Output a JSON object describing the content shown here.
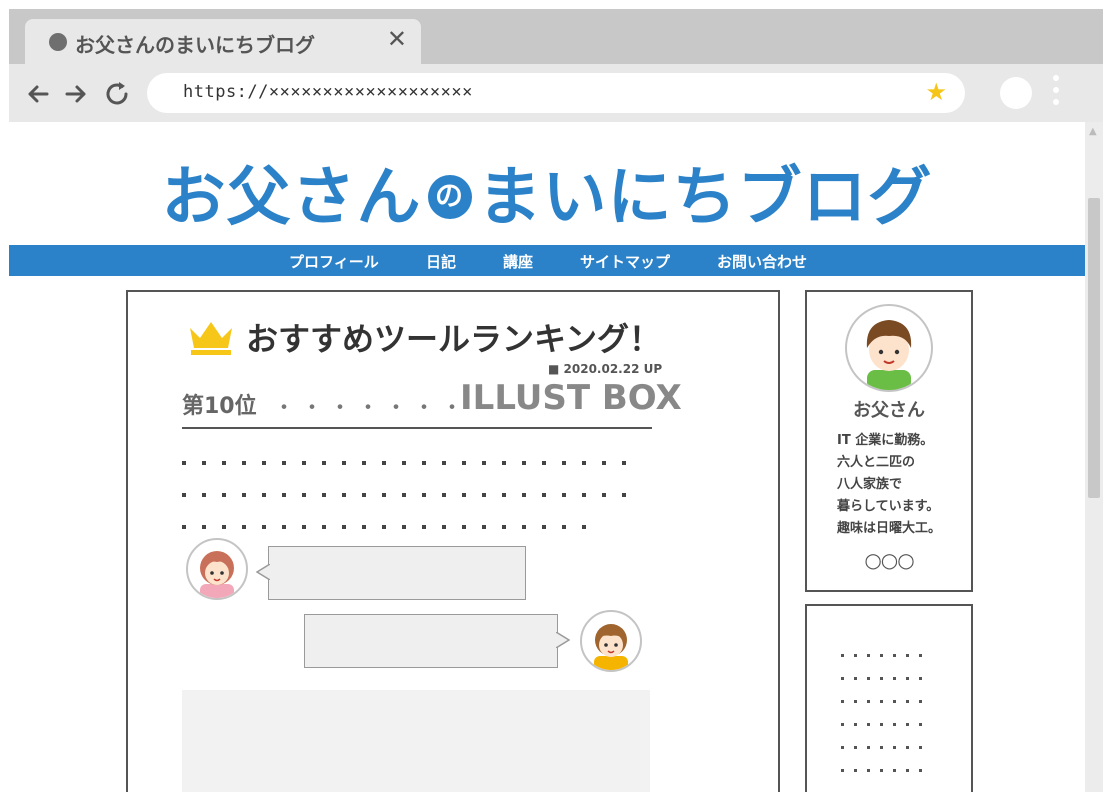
{
  "browser": {
    "tab_title": "お父さんのまいにちブログ",
    "tab_close": "✕",
    "url": "https://×××××××××××××××××××",
    "bookmark_star": "★",
    "icons": [
      "back-arrow-icon",
      "forward-arrow-icon",
      "reload-icon",
      "star-icon",
      "profile-icon",
      "menu-dots-icon",
      "close-icon"
    ]
  },
  "site": {
    "title_part1": "お父さん",
    "title_no": "の",
    "title_part2": "まいにちブログ",
    "accent_color": "#2b82c8"
  },
  "nav": {
    "items": [
      "プロフィール",
      "日記",
      "講座",
      "サイトマップ",
      "お問い合わせ"
    ]
  },
  "post": {
    "title": "おすすめツールランキング！",
    "date": "■ 2020.02.22 UP",
    "rank_label": "第10位",
    "rank_dots": "・・・・・・・・・",
    "rank_item": "ILLUST BOX"
  },
  "sidebar": {
    "name": "お父さん",
    "bio": [
      "IT 企業に勤務。",
      "六人と二匹の",
      "八人家族で",
      "暮らしています。",
      "趣味は日曜大工。"
    ],
    "circles": "○○○"
  }
}
